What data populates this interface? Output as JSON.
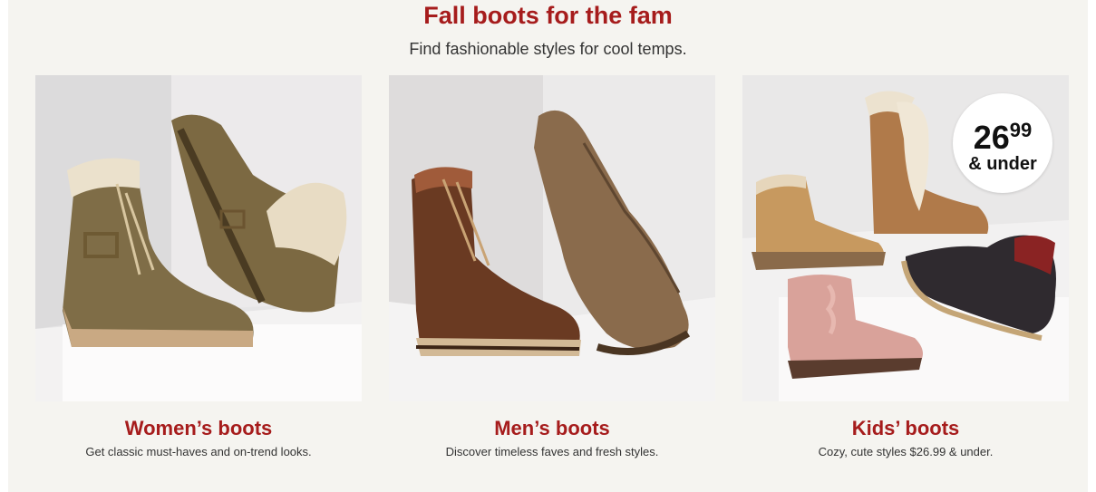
{
  "header": {
    "title": "Fall boots for the fam",
    "subtitle": "Find fashionable styles for cool temps."
  },
  "cards": [
    {
      "heading": "Women’s boots",
      "description": "Get classic must-haves and on-trend looks."
    },
    {
      "heading": "Men’s boots",
      "description": "Discover timeless faves and fresh styles."
    },
    {
      "heading": "Kids’ boots",
      "description": "Cozy, cute styles $26.99 & under."
    }
  ],
  "badge": {
    "dollars": "26",
    "cents": "99",
    "suffix": "& under"
  },
  "colors": {
    "accent": "#a61c1c",
    "panel": "#f5f4f0",
    "text": "#333333"
  }
}
